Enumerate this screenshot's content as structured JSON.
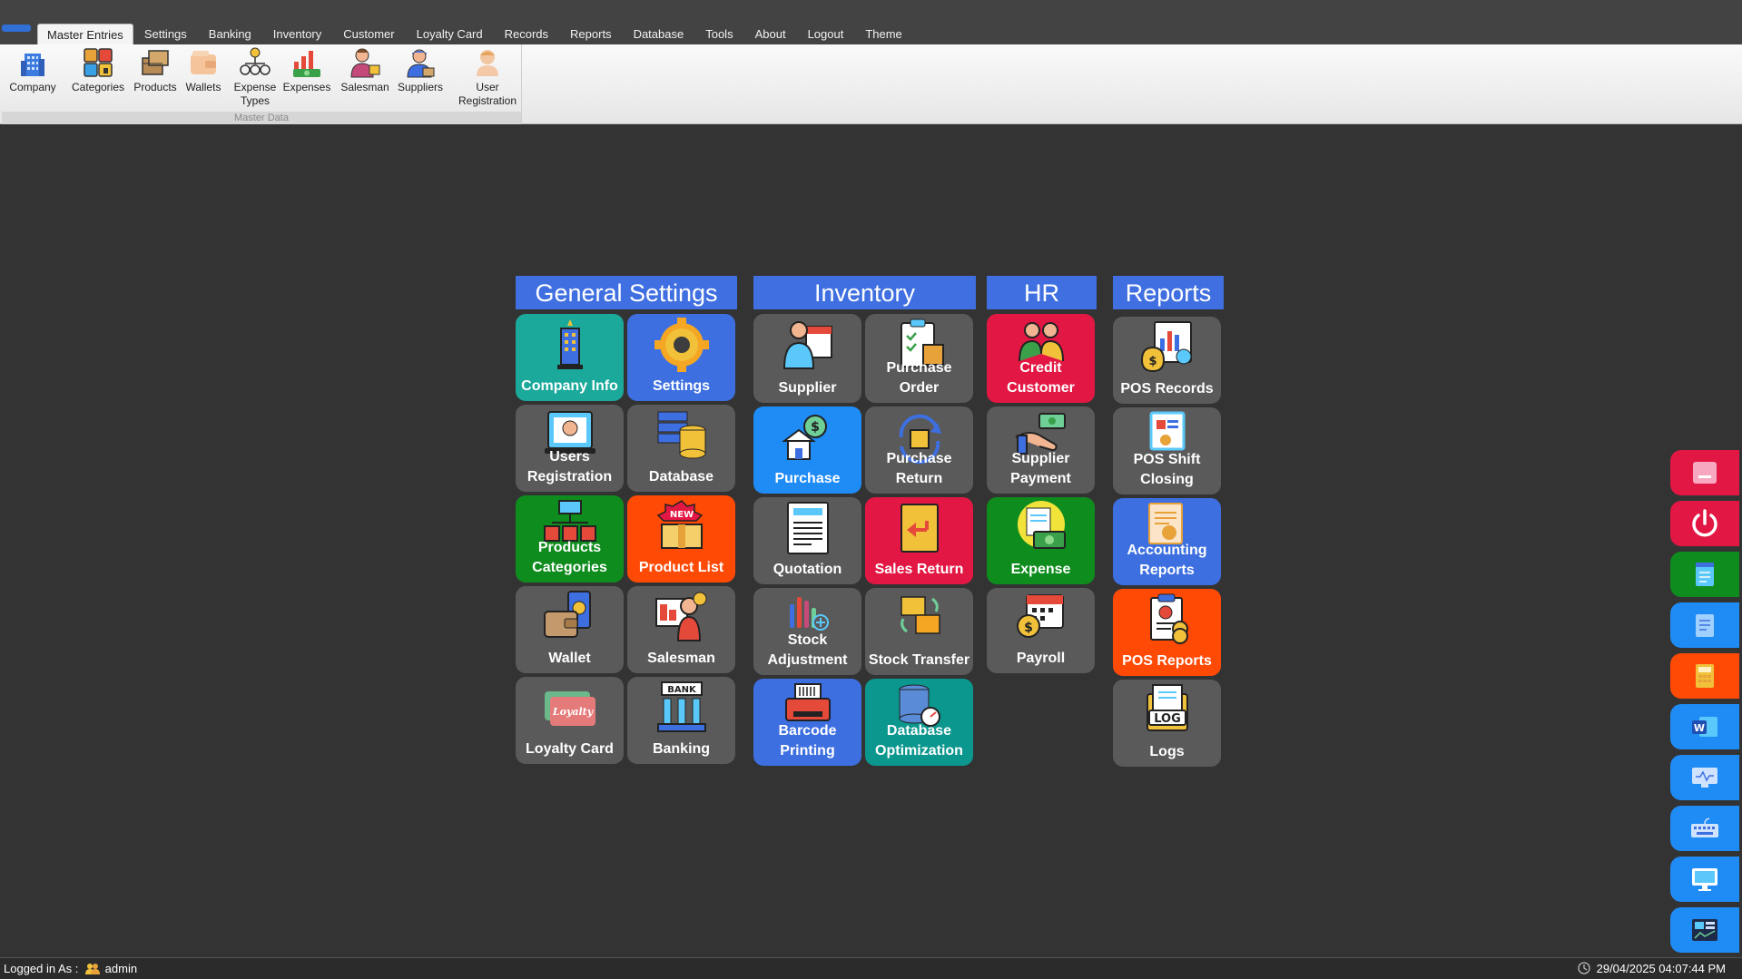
{
  "menu": {
    "tabs": [
      "Master Entries",
      "Settings",
      "Banking",
      "Inventory",
      "Customer",
      "Loyalty Card",
      "Records",
      "Reports",
      "Database",
      "Tools",
      "About",
      "Logout",
      "Theme"
    ],
    "active": "Master Entries"
  },
  "ribbon": {
    "group_label": "Master Data",
    "buttons": {
      "company": "Company",
      "categories": "Categories",
      "products": "Products",
      "wallets": "Wallets",
      "expense_types": "Expense Types",
      "expenses": "Expenses",
      "salesman": "Salesman",
      "suppliers": "Suppliers",
      "user_registration": "User Registration"
    }
  },
  "sections": {
    "general": {
      "title": "General Settings",
      "company_info": "Company Info",
      "settings": "Settings",
      "users_registration": "Users Registration",
      "database": "Database",
      "products_categories": "Products Categories",
      "product_list": "Product List",
      "wallet": "Wallet",
      "salesman": "Salesman",
      "loyalty_card": "Loyalty Card",
      "banking": "Banking"
    },
    "inventory": {
      "title": "Inventory",
      "supplier": "Supplier",
      "purchase_order": "Purchase Order",
      "purchase": "Purchase",
      "purchase_return": "Purchase Return",
      "quotation": "Quotation",
      "sales_return": "Sales Return",
      "stock_adjustment": "Stock Adjustment",
      "stock_transfer": "Stock Transfer",
      "barcode_printing": "Barcode Printing",
      "database_optimization": "Database Optimization"
    },
    "hr": {
      "title": "HR",
      "credit_customer": "Credit Customer",
      "supplier_payment": "Supplier Payment",
      "expense": "Expense",
      "payroll": "Payroll"
    },
    "reports": {
      "title": "Reports",
      "pos_records": "POS Records",
      "pos_shift_closing": "POS Shift Closing",
      "accounting_reports": "Accounting Reports",
      "pos_reports": "POS Reports",
      "logs": "Logs",
      "loyalty_badge": "Loyalty",
      "log_badge": "LOG",
      "bank_badge": "BANK",
      "new_badge": "NEW"
    }
  },
  "dock": {
    "icons": [
      "minimize-icon",
      "power-icon",
      "notepad-icon",
      "document-icon",
      "calculator-icon",
      "word-icon",
      "monitor-icon",
      "keyboard-icon",
      "desktop-icon",
      "dashboard-icon"
    ],
    "colors": [
      "#e31743",
      "#e31743",
      "#0f8c1e",
      "#1f8bf5",
      "#ff4a06",
      "#1f8bf5",
      "#1f8bf5",
      "#1f8bf5",
      "#1f8bf5",
      "#1f8bf5"
    ]
  },
  "status": {
    "logged_in_label": "Logged in As :",
    "user": "admin",
    "datetime": "29/04/2025 04:07:44 PM"
  }
}
